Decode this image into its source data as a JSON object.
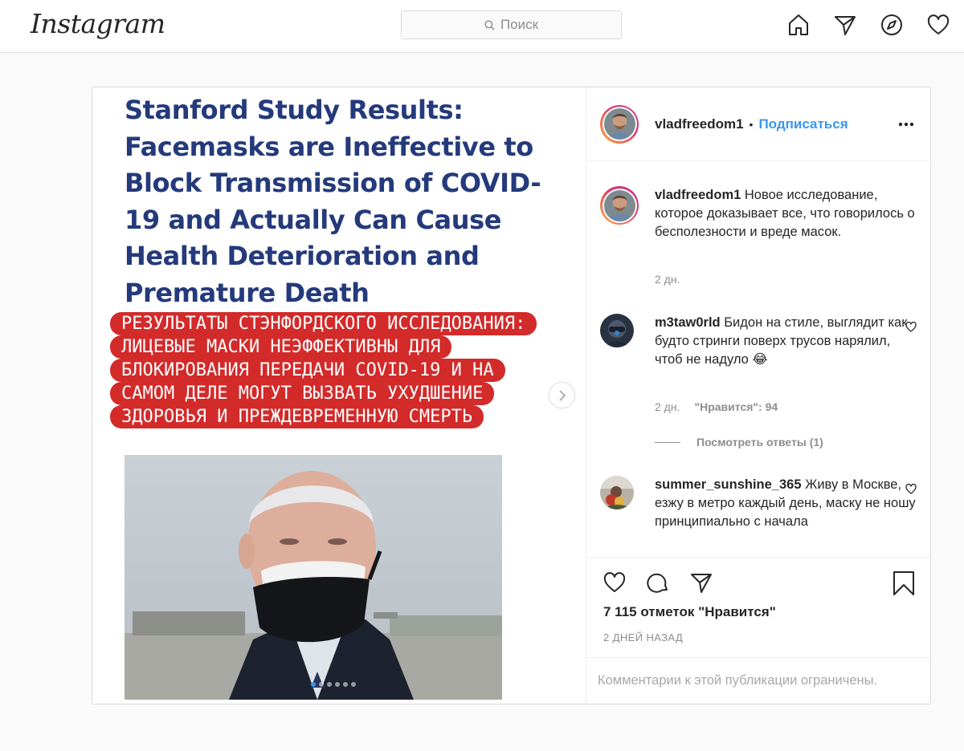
{
  "nav": {
    "logo": "Instagram",
    "search_placeholder": "Поиск",
    "icons": [
      "home-icon",
      "direct-icon",
      "explore-icon",
      "activity-heart-icon"
    ]
  },
  "post": {
    "author": "vladfreedom1",
    "separator": "•",
    "follow_label": "Подписаться",
    "image": {
      "english_title": "Stanford Study Results: Facemasks are Ineffective to Block Transmission of COVID-19 and Actually Can Cause Health Deterioration and Premature Death",
      "russian_lines": [
        "РЕЗУЛЬТАТЫ СТЭНФОРДСКОГО ИССЛЕДОВАНИЯ:",
        "ЛИЦЕВЫЕ МАСКИ НЕЭФФЕКТИВНЫ ДЛЯ",
        "БЛОКИРОВАНИЯ ПЕРЕДАЧИ COVID-19 И НА",
        "САМОМ ДЕЛЕ МОГУТ ВЫЗВАТЬ УХУДШЕНИЕ",
        "ЗДОРОВЬЯ И ПРЕЖДЕВРЕМЕННУЮ СМЕРТЬ"
      ],
      "carousel_count": 6,
      "carousel_active": 1
    },
    "caption": {
      "user": "vladfreedom1",
      "text": "Новое исследование, которое доказывает все, что говорилось о бесполезности и вреде масок.",
      "time": "2 дн."
    },
    "comments": [
      {
        "user": "m3taw0rld",
        "text": "Бидон на стиле, выглядит как будто стринги поверх трусов нарялил, чтоб не надуло 😂",
        "time": "2 дн.",
        "likes": "\"Нравится\": 94",
        "replies": "Посмотреть ответы (1)"
      },
      {
        "user": "summer_sunshine_365",
        "text": "Живу в Москве, езжу в метро каждый день, маску не ношу принципиально с начала"
      }
    ],
    "likes_text": "7 115 отметок \"Нравится\"",
    "date_text": "2 ДНЕЙ НАЗАД",
    "comments_limited": "Комментарии к этой публикации ограничены."
  },
  "colors": {
    "accent_blue": "#3897f0",
    "title_navy": "#243a7b",
    "banner_red": "#d32a2a",
    "border": "#dbdbdb"
  }
}
